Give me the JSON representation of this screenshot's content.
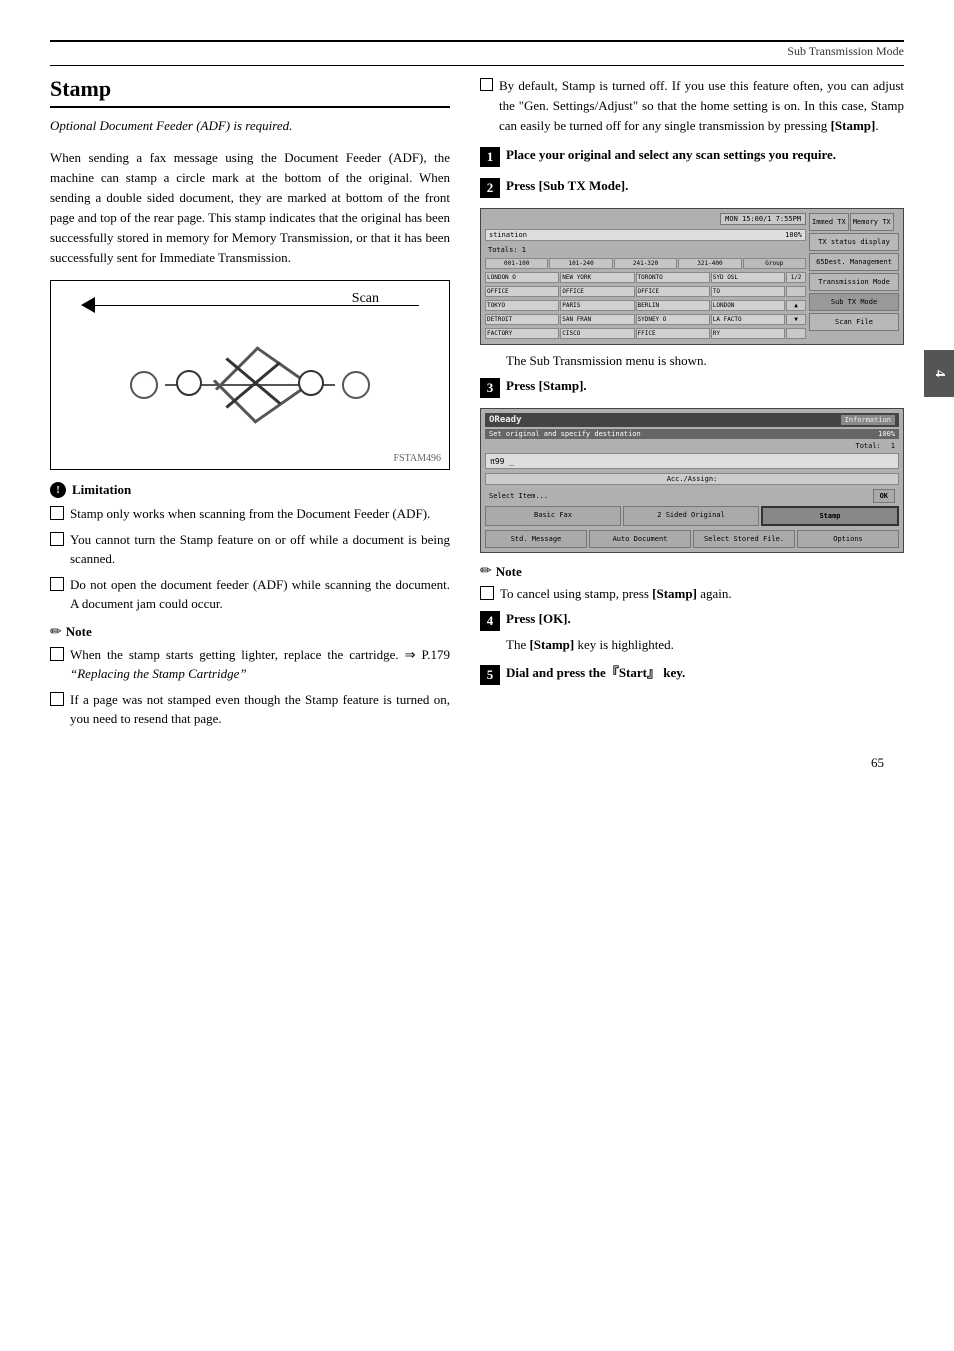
{
  "header": {
    "section_title": "Sub Transmission Mode"
  },
  "page_number": "65",
  "chapter_tab": "4",
  "left_column": {
    "title": "Stamp",
    "subtitle": "Optional Document Feeder (ADF) is required.",
    "body_paragraphs": [
      "When sending a fax message using the Document Feeder (ADF), the machine can stamp a circle mark at the bottom of the original. When sending a double sided document, they are marked at bottom of the front page and top of the rear page. This stamp indicates that the original has been successfully stored in memory for Memory Transmission, or that it has been successfully sent for Immediate Transmission.",
      ""
    ],
    "scan_label": "Scan",
    "diagram_code": "FSTAM496",
    "limitation": {
      "header": "Limitation",
      "items": [
        "Stamp only works when scanning from the Document Feeder (ADF).",
        "You cannot turn the Stamp feature on or off while a document is being scanned.",
        "Do not open the document feeder (ADF) while scanning the document. A document jam could occur."
      ]
    },
    "note": {
      "header": "Note",
      "items": [
        "When the stamp starts getting lighter, replace the cartridge. ⇒ P.179 “Replacing the Stamp Cartridge”",
        "If a page was not stamped even though the Stamp feature is turned on, you need to resend that page."
      ],
      "note1_link": "P.179",
      "note1_italic": "“Replacing the Stamp Cartridge”"
    }
  },
  "right_column": {
    "intro_bullet": "By default, Stamp is turned off. If you use this feature often, you can adjust the \"Gen. Settings/Adjust\" so that the home setting is on. In this case, Stamp can easily be turned off for any single transmission by pressing [Stamp].",
    "steps": [
      {
        "num": "1",
        "text": "Place your original and select any scan settings you require."
      },
      {
        "num": "2",
        "text": "Press [Sub TX Mode]."
      },
      {
        "num": "3",
        "text": "Press [Stamp]."
      },
      {
        "num": "4",
        "text": "Press [OK]."
      },
      {
        "num": "5",
        "text": "Dial and press the『Start』 key."
      }
    ],
    "sub_tx_shown_text": "The Sub Transmission menu is shown.",
    "stamp_ok_text": "The [Stamp] key is highlighted.",
    "note2": {
      "header": "Note",
      "items": [
        "To cancel using stamp, press [Stamp] again."
      ]
    },
    "screen1": {
      "time": "MON 15:00/1 7:55PM",
      "dest_label": "stination",
      "percent": "100%",
      "tab1": "Immed TX",
      "tab2": "Memory TX",
      "totals_label": "Totals:",
      "totals_val": "1",
      "tx_status_btn": "TX status display",
      "dest_mgmt_btn": "65Dest. Management",
      "tx_mode_btn": "Transmission Mode",
      "sub_tx_btn": "Sub TX Mode",
      "scan_file_btn": "Scan File",
      "ranges": [
        "001-100",
        "101-240",
        "241-320",
        "321-400",
        "Group"
      ],
      "rows": [
        [
          "LONDON O",
          "NEW YORK",
          "TORONTO",
          "SYD OSL",
          "1/2"
        ],
        [
          "OFFICE",
          "OFFICE",
          "OFFICE",
          "TO",
          ""
        ],
        [
          "TOKYO",
          "PARIS",
          "BERLIN",
          "LONDON",
          ""
        ],
        [
          "DETROIT",
          "SAN FRAN",
          "SYDNEY O",
          "LA FACTO",
          ""
        ],
        [
          "FACTORY",
          "CISCO",
          "FFICE",
          "RY",
          ""
        ]
      ]
    },
    "screen2": {
      "ready_text": "OReady",
      "info_btn": "Information",
      "dest_text": "Set original and specify destination",
      "percent": "100%",
      "total_label": "Total:",
      "total_val": "1",
      "input_val": "π99 _",
      "accel_label": "Acc./Assign:",
      "select_text": "Select Item...",
      "ok_btn": "OK",
      "buttons_row1": [
        "Basic Fax",
        "2 Sided Original",
        "Stamp"
      ],
      "buttons_row2": [
        "Std. Message",
        "Auto Document",
        "Select Stored File.",
        "Options"
      ]
    }
  }
}
